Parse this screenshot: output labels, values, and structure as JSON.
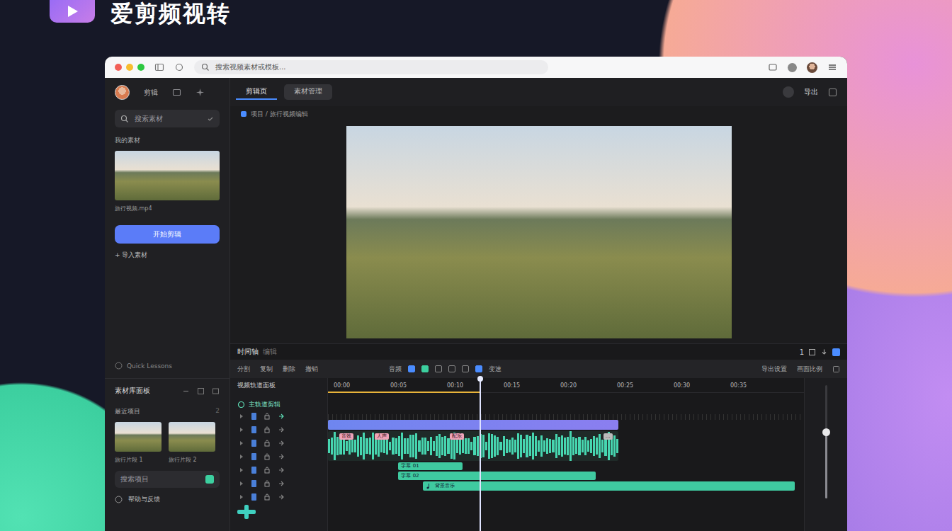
{
  "app": {
    "title": "爱剪频视转"
  },
  "browser": {
    "address": "搜索视频素材或模板..."
  },
  "sidebar": {
    "nav_label": "剪辑",
    "search_placeholder": "搜索素材",
    "heading": "我的素材",
    "caption": "旅行视频.mp4",
    "button": "开始剪辑",
    "import": "+ 导入素材",
    "lessons": "Quick Lessons"
  },
  "library": {
    "title": "素材库面板",
    "section": "最近项目",
    "count": "2",
    "recent": [
      {
        "caption": "旅行片段 1"
      },
      {
        "caption": "旅行片段 2"
      }
    ],
    "search_placeholder": "搜索项目",
    "footer": "帮助与反馈"
  },
  "tabs": [
    {
      "label": "剪辑页",
      "selected": true
    },
    {
      "label": "素材管理",
      "selected": false
    }
  ],
  "header": {
    "export": "导出"
  },
  "breadcrumb": "项目 / 旅行视频编辑",
  "timeline": {
    "title": "时间轴",
    "subtitle": "编辑",
    "zoom": "1",
    "tools_left": [
      "分割",
      "复制",
      "删除",
      "撤销"
    ],
    "tool_center": "音频",
    "tool_speed": "变速",
    "tools_right": [
      "导出设置",
      "画面比例"
    ],
    "track_panel_title": "视频轨道面板",
    "main_track": "主轨道剪辑",
    "ruler": [
      "00:00",
      "00:05",
      "00:10",
      "00:15",
      "00:20",
      "00:25",
      "00:30",
      "00:35"
    ],
    "playhead": 0.32,
    "lanes": [
      {
        "kind": "video",
        "label": ""
      },
      {
        "kind": "audio",
        "label": "",
        "tags": [
          "音效",
          "人声",
          "配乐",
          "…"
        ]
      },
      {
        "kind": "text",
        "label": "字幕 01"
      },
      {
        "kind": "text",
        "label": "字幕 02"
      },
      {
        "kind": "music",
        "label": "背景音乐"
      }
    ],
    "volume": {
      "level": 0.58
    }
  }
}
